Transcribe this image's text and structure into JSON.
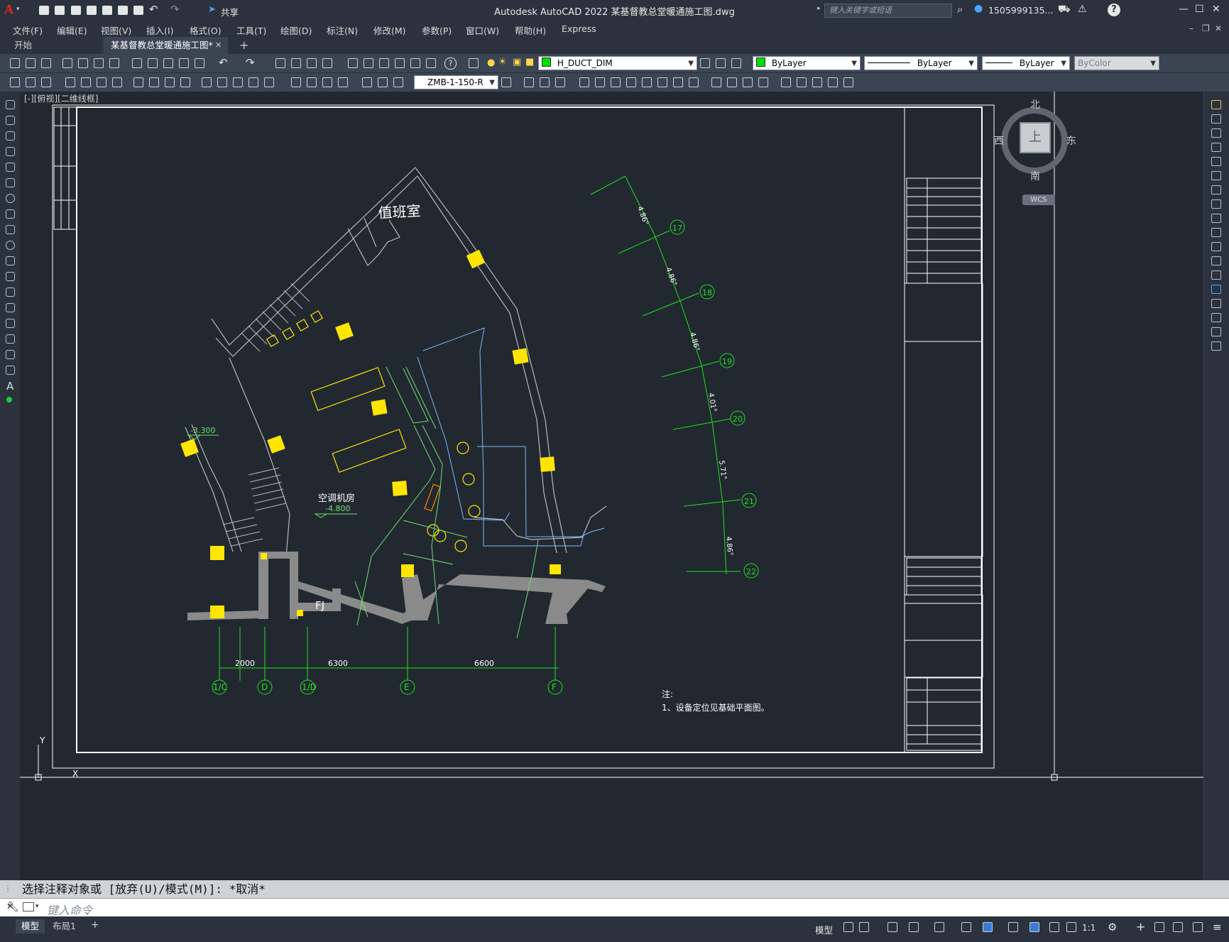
{
  "app": {
    "title": "Autodesk AutoCAD 2022    某基督教总堂暖通施工图.dwg",
    "share_label": "共享",
    "search_placeholder": "键入关键字或短语",
    "user": "1505999135...",
    "help": "?"
  },
  "menu": [
    "文件(F)",
    "编辑(E)",
    "视图(V)",
    "插入(I)",
    "格式(O)",
    "工具(T)",
    "绘图(D)",
    "标注(N)",
    "修改(M)",
    "参数(P)",
    "窗口(W)",
    "帮助(H)",
    "Express"
  ],
  "tabs": {
    "start": "开始",
    "file": "某基督教总堂暖通施工图*",
    "close": "✕",
    "add": "+"
  },
  "properties": {
    "layer": "H_DUCT_DIM",
    "color": "ByLayer",
    "linetype": "ByLayer",
    "lineweight": "ByLayer",
    "plotstyle": "ByColor",
    "dimstyle": "ZMB-1-150-R"
  },
  "viewport_label": "[-][俯视][二维线框]",
  "viewcube": {
    "north": "北",
    "south": "南",
    "east": "东",
    "west": "西",
    "top": "上",
    "wcs": "WCS"
  },
  "drawing": {
    "room_duty": "值班室",
    "room_ac": "空调机房",
    "level_ac": "-4.800",
    "level_left": "-3.300",
    "fj": "FJ",
    "grid_bottom": [
      "1/C",
      "D",
      "1/D",
      "E",
      "F"
    ],
    "dims_bottom": [
      "2000",
      "6300",
      "6600"
    ],
    "grid_right": [
      "17",
      "18",
      "19",
      "20",
      "21",
      "22"
    ],
    "angle_labels": [
      "4.86°",
      "4.86°",
      "4.86°",
      "4.01°",
      "5.71°",
      "4.86°"
    ],
    "note_title": "注:",
    "note_1": "1、设备定位见基础平面图。"
  },
  "command": {
    "history": "选择注释对象或 [放弃(U)/模式(M)]: *取消*",
    "placeholder": "键入命令"
  },
  "status": {
    "model_tab": "模型",
    "layout_tab": "布局1",
    "add": "+",
    "model_btn": "模型",
    "scale": "1:1"
  }
}
